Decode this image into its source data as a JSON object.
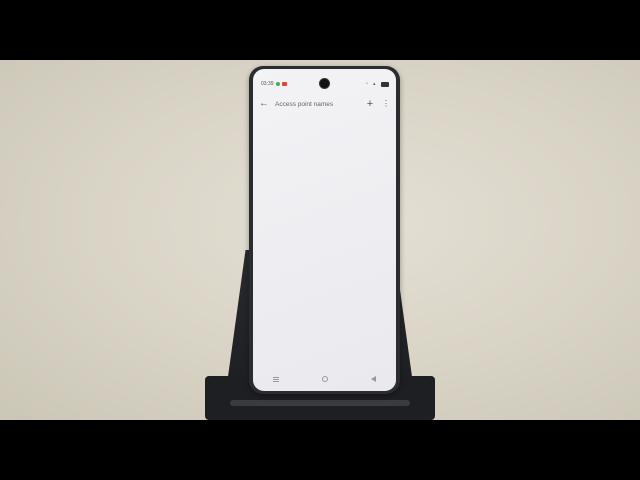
{
  "status_bar": {
    "time": "03:39"
  },
  "app_bar": {
    "title": "Access point names",
    "back_icon": "arrow-left-icon",
    "add_icon": "plus-icon",
    "more_icon": "more-vert-icon"
  },
  "nav_bar": {
    "icons": [
      "recent-apps-icon",
      "home-icon",
      "back-triangle-icon"
    ]
  },
  "colors": {
    "screen_bg": "#f0f0f3",
    "phone_frame": "#2a2c30",
    "wall": "#d8d3c5"
  }
}
